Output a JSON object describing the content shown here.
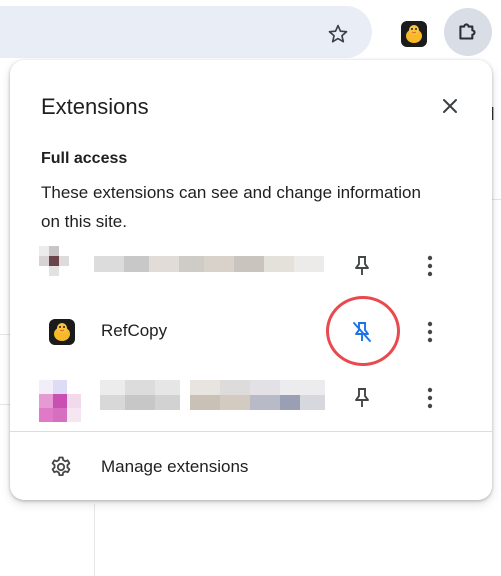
{
  "toolbar": {
    "icons": [
      "star-icon",
      "refcopy-extension-icon",
      "puzzle-icon"
    ]
  },
  "popup": {
    "title": "Extensions",
    "close_icon": "close-icon",
    "section": {
      "title": "Full access",
      "description": "These extensions can see and change information on this site."
    },
    "extensions": [
      {
        "name": "",
        "pinned": false,
        "icon": "blurred-extension-icon"
      },
      {
        "name": "RefCopy",
        "pinned": true,
        "icon": "refcopy-extension-icon",
        "highlighted": true
      },
      {
        "name": "",
        "pinned": false,
        "icon": "blurred-extension-icon"
      }
    ],
    "manage": {
      "label": "Manage extensions",
      "icon": "gear-icon"
    }
  },
  "colors": {
    "pin_active": "#1a73e8",
    "pin_inactive": "#444746",
    "highlight": "#e84a4f",
    "omnibox": "#e9eef6"
  }
}
